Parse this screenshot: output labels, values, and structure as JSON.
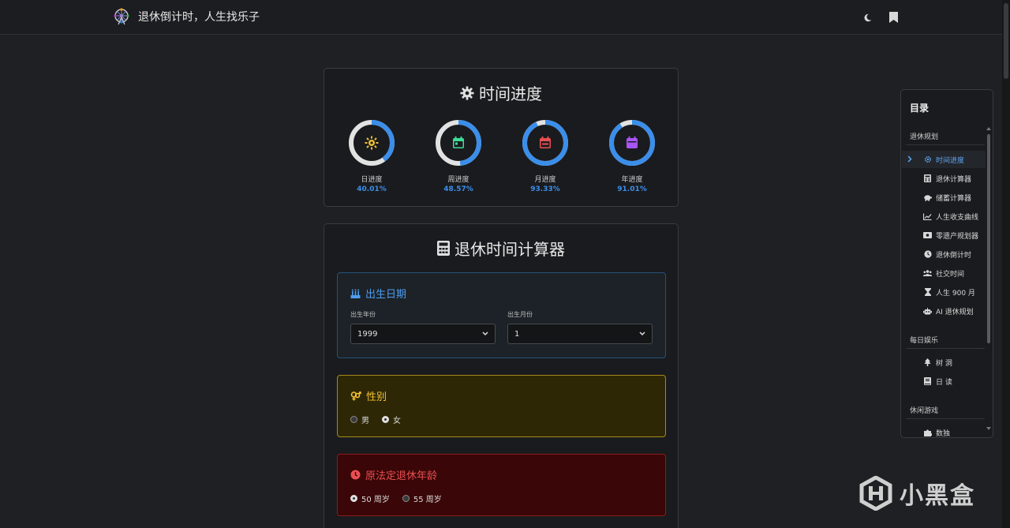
{
  "navbar": {
    "brand_text": "退休倒计时，人生找乐子",
    "icons": {
      "logo": "ferris-wheel-icon",
      "theme": "moon-icon",
      "bookmark": "bookmark-icon"
    }
  },
  "progress": {
    "title": "时间进度",
    "items": [
      {
        "label": "日进度",
        "value_text": "40.01%",
        "value": 40.01,
        "icon": "sun-icon",
        "icon_color": "#f1c232"
      },
      {
        "label": "周进度",
        "value_text": "48.57%",
        "value": 48.57,
        "icon": "calendar-week-icon",
        "icon_color": "#3ddc97"
      },
      {
        "label": "月进度",
        "value_text": "93.33%",
        "value": 93.33,
        "icon": "calendar-month-icon",
        "icon_color": "#ea4f52"
      },
      {
        "label": "年进度",
        "value_text": "91.01%",
        "value": 91.01,
        "icon": "calendar-year-icon",
        "icon_color": "#a855f7"
      }
    ],
    "ring_color": "#3b8eea",
    "ring_track_color": "#e2e2e2"
  },
  "calculator": {
    "title": "退休时间计算器",
    "birth": {
      "heading": "出生日期",
      "year_label": "出生年份",
      "year_value": "1999",
      "month_label": "出生月份",
      "month_value": "1"
    },
    "gender": {
      "heading": "性别",
      "options": [
        {
          "label": "男",
          "checked": false
        },
        {
          "label": "女",
          "checked": true
        }
      ]
    },
    "retire_age": {
      "heading": "原法定退休年龄",
      "options": [
        {
          "label": "50 周岁",
          "checked": true
        },
        {
          "label": "55 周岁",
          "checked": false
        }
      ]
    }
  },
  "toc": {
    "title": "目录",
    "groups": [
      {
        "name": "退休规划"
      },
      {
        "name": "每日娱乐"
      },
      {
        "name": "休闲游戏"
      }
    ],
    "items": [
      {
        "label": "时间进度",
        "icon": "gear-icon",
        "active": true
      },
      {
        "label": "退休计算器",
        "icon": "calculator-icon",
        "active": false
      },
      {
        "label": "储蓄计算器",
        "icon": "piggy-bank-icon",
        "active": false
      },
      {
        "label": "人生收支曲线",
        "icon": "line-chart-icon",
        "active": false
      },
      {
        "label": "零遗产规划器",
        "icon": "money-icon",
        "active": false
      },
      {
        "label": "退休倒计时",
        "icon": "clock-icon",
        "active": false
      },
      {
        "label": "社交时间",
        "icon": "users-icon",
        "active": false
      },
      {
        "label": "人生 900 月",
        "icon": "hourglass-icon",
        "active": false
      },
      {
        "label": "AI 退休规划",
        "icon": "robot-icon",
        "active": false
      },
      {
        "label": "树 洞",
        "icon": "tree-icon",
        "active": false
      },
      {
        "label": "日 读",
        "icon": "book-icon",
        "active": false
      },
      {
        "label": "数独",
        "icon": "puzzle-icon",
        "active": false
      }
    ]
  },
  "watermark": {
    "text": "小黑盒"
  }
}
